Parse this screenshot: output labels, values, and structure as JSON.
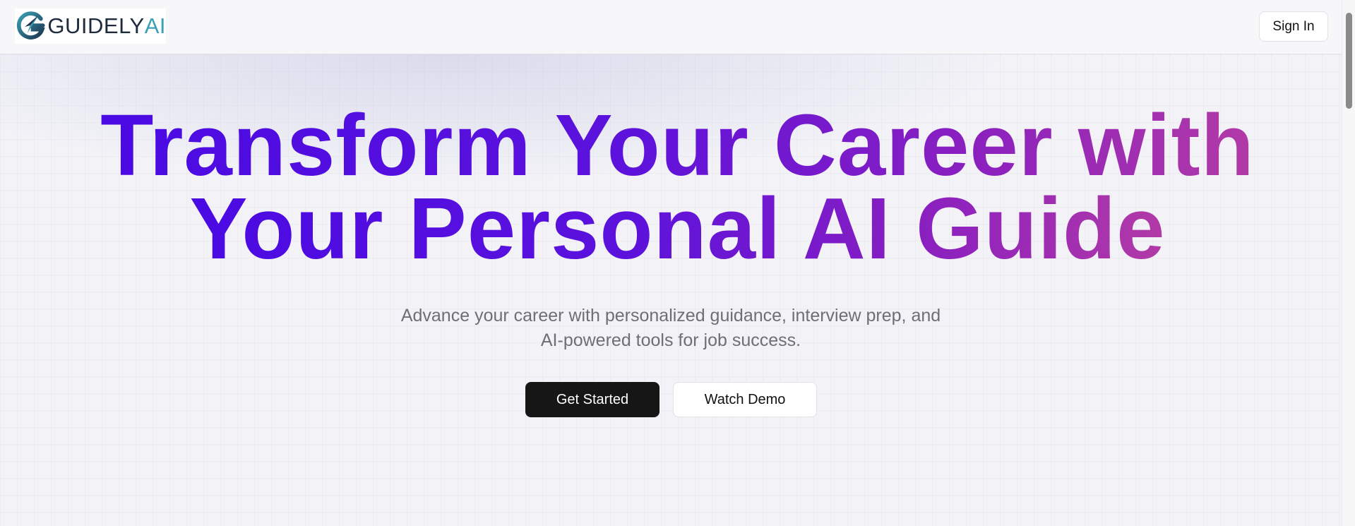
{
  "brand": {
    "name_part1": "GUIDELY",
    "name_part2": "AI",
    "logo_icon": "compass-g-icon",
    "primary_color": "#1d2b3c",
    "accent_color": "#3aa0b5"
  },
  "header": {
    "sign_in_label": "Sign In"
  },
  "hero": {
    "headline_line1": "Transform Your Career with",
    "headline_line2": "Your Personal AI Guide",
    "subtitle": "Advance your career with personalized guidance, interview prep, and AI-powered tools for job success.",
    "gradient_start": "#4a0ae3",
    "gradient_end": "#b23aa6"
  },
  "actions": {
    "primary_label": "Get Started",
    "secondary_label": "Watch Demo"
  }
}
